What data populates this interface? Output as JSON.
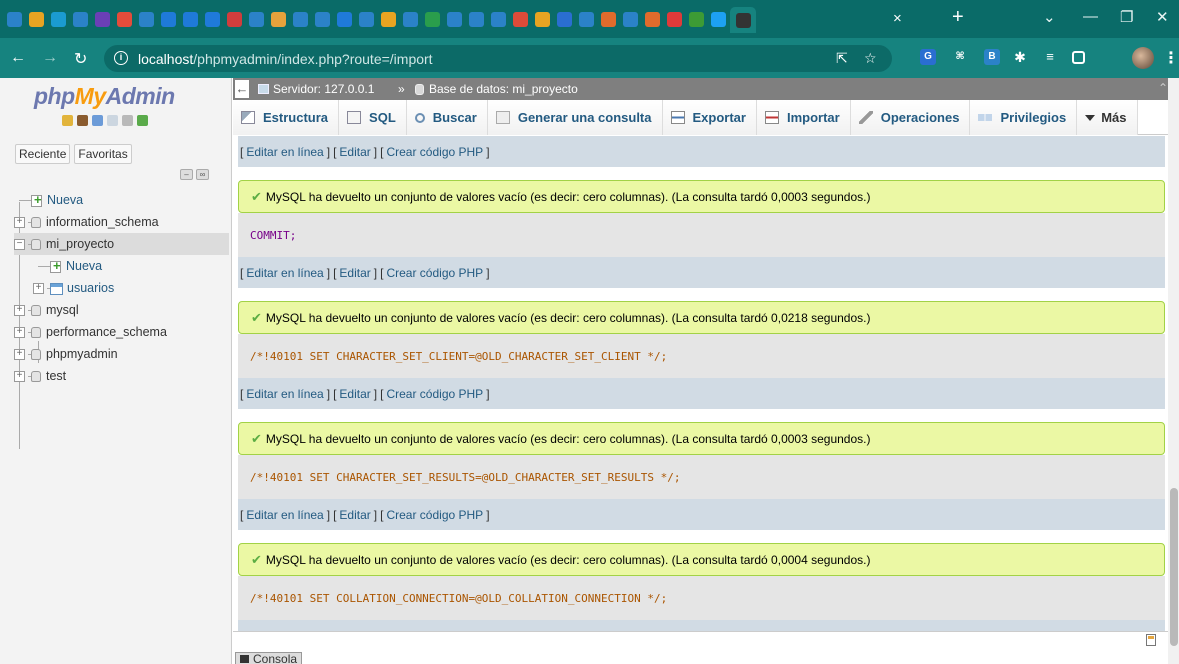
{
  "browser": {
    "url_host": "localhost",
    "url_path": "/phpmyadmin/index.php?route=/import",
    "tab_close": "×",
    "new_tab": "+",
    "tab_colors": [
      "#2b82c8",
      "#e8a422",
      "#1b9bd1",
      "#2b82c8",
      "#6b3fb6",
      "#e44c3b",
      "#2b82c8",
      "#1f7ad9",
      "#1f7ad9",
      "#1f7ad9",
      "#d13d3d",
      "#2b82c8",
      "#e6a23c",
      "#2b82c8",
      "#2b82c8",
      "#1f7ad9",
      "#2b82c8",
      "#e8a422",
      "#2b82c8",
      "#2a9d4c",
      "#2b82c8",
      "#2b82c8",
      "#2b82c8",
      "#dd4b39",
      "#e8a422",
      "#2a6ed1",
      "#2b82c8",
      "#e06b2c",
      "#2b82c8",
      "#e06b2c",
      "#e03a3a",
      "#3d9b35",
      "#1da1f2",
      "#333333"
    ]
  },
  "nav": {
    "logo_php": "php",
    "logo_my": "My",
    "logo_admin": "Admin",
    "tab_recent": "Reciente",
    "tab_favorites": "Favoritas",
    "tree": [
      {
        "label": "Nueva",
        "kind": "new",
        "level": 0
      },
      {
        "label": "information_schema",
        "kind": "db",
        "level": 0
      },
      {
        "label": "mi_proyecto",
        "kind": "db",
        "level": 0,
        "expanded": true,
        "selected": true
      },
      {
        "label": "Nueva",
        "kind": "new",
        "level": 1
      },
      {
        "label": "usuarios",
        "kind": "table",
        "level": 1
      },
      {
        "label": "mysql",
        "kind": "db",
        "level": 0
      },
      {
        "label": "performance_schema",
        "kind": "db",
        "level": 0
      },
      {
        "label": "phpmyadmin",
        "kind": "db",
        "level": 0
      },
      {
        "label": "test",
        "kind": "db",
        "level": 0
      }
    ]
  },
  "breadcrumb": {
    "server": "Servidor: 127.0.0.1",
    "separator": "»",
    "database": "Base de datos: mi_proyecto"
  },
  "menu": [
    {
      "label": "Estructura",
      "icon": "structure-icon"
    },
    {
      "label": "SQL",
      "icon": "sql-icon"
    },
    {
      "label": "Buscar",
      "icon": "search-icon"
    },
    {
      "label": "Generar una consulta",
      "icon": "query-icon"
    },
    {
      "label": "Exportar",
      "icon": "export-icon"
    },
    {
      "label": "Importar",
      "icon": "import-icon"
    },
    {
      "label": "Operaciones",
      "icon": "wrench-icon"
    },
    {
      "label": "Privilegios",
      "icon": "privileges-icon"
    },
    {
      "label": "Más",
      "icon": "chevron-down-icon"
    }
  ],
  "edit_links": {
    "open": "[",
    "close": "]",
    "edit_inline": "Editar en línea",
    "edit": "Editar",
    "create_php": "Crear código PHP"
  },
  "results": [
    {
      "message": "MySQL ha devuelto un conjunto de valores vacío (es decir: cero columnas). (La consulta tardó 0,0003 segundos.)",
      "sql": "COMMIT;",
      "sql_type": "keyword"
    },
    {
      "message": "MySQL ha devuelto un conjunto de valores vacío (es decir: cero columnas). (La consulta tardó 0,0218 segundos.)",
      "sql": "/*!40101 SET CHARACTER_SET_CLIENT=@OLD_CHARACTER_SET_CLIENT */;",
      "sql_type": "comment"
    },
    {
      "message": "MySQL ha devuelto un conjunto de valores vacío (es decir: cero columnas). (La consulta tardó 0,0003 segundos.)",
      "sql": "/*!40101 SET CHARACTER_SET_RESULTS=@OLD_CHARACTER_SET_RESULTS */;",
      "sql_type": "comment"
    },
    {
      "message": "MySQL ha devuelto un conjunto de valores vacío (es decir: cero columnas). (La consulta tardó 0,0004 segundos.)",
      "sql": "/*!40101 SET COLLATION_CONNECTION=@OLD_COLLATION_CONNECTION */;",
      "sql_type": "comment"
    }
  ],
  "console": {
    "label": "Consola"
  },
  "colors": {
    "accent": "#16837f",
    "link": "#235a81",
    "success_bg": "#ebf8a4",
    "edit_bg": "#d1dbe4"
  }
}
